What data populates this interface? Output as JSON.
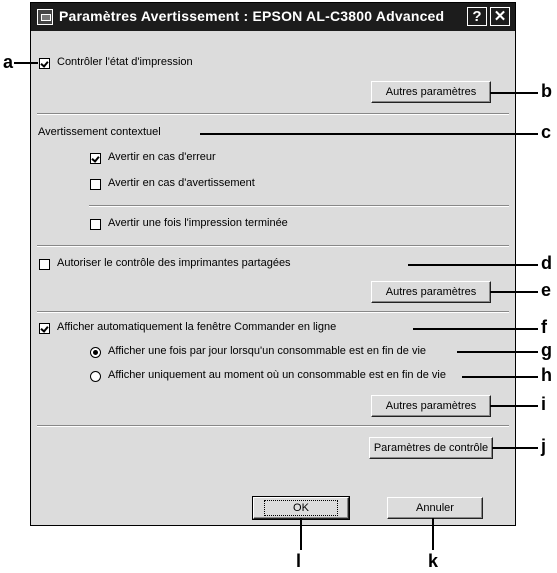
{
  "window": {
    "title": "Paramètres Avertissement : EPSON AL-C3800 Advanced",
    "help_label": "?",
    "close_label": "✕"
  },
  "options": {
    "monitor_status": {
      "label": "Contrôler l'état d'impression",
      "checked": true
    },
    "other_settings_1": "Autres paramètres",
    "popup_heading": "Avertissement contextuel",
    "warn_error": {
      "label": "Avertir en cas d'erreur",
      "checked": true
    },
    "warn_warning": {
      "label": "Avertir en cas d'avertissement",
      "checked": false
    },
    "warn_done": {
      "label": "Avertir une fois l'impression terminée",
      "checked": false
    },
    "shared_printers": {
      "label": "Autoriser le contrôle des imprimantes partagées",
      "checked": false
    },
    "other_settings_2": "Autres paramètres",
    "order_online": {
      "label": "Afficher automatiquement la fenêtre Commander en ligne",
      "checked": true
    },
    "once_per_day": {
      "label": "Afficher une fois par jour lorsqu'un consommable est en fin de vie",
      "selected": true
    },
    "only_when": {
      "label": "Afficher uniquement au moment où un consommable est en fin de vie",
      "selected": false
    },
    "other_settings_3": "Autres paramètres",
    "monitoring_prefs": "Paramètres de contrôle"
  },
  "footer": {
    "ok": "OK",
    "cancel": "Annuler"
  },
  "callouts": {
    "a": "a",
    "b": "b",
    "c": "c",
    "d": "d",
    "e": "e",
    "f": "f",
    "g": "g",
    "h": "h",
    "i": "i",
    "j": "j",
    "k": "k",
    "l": "l"
  }
}
